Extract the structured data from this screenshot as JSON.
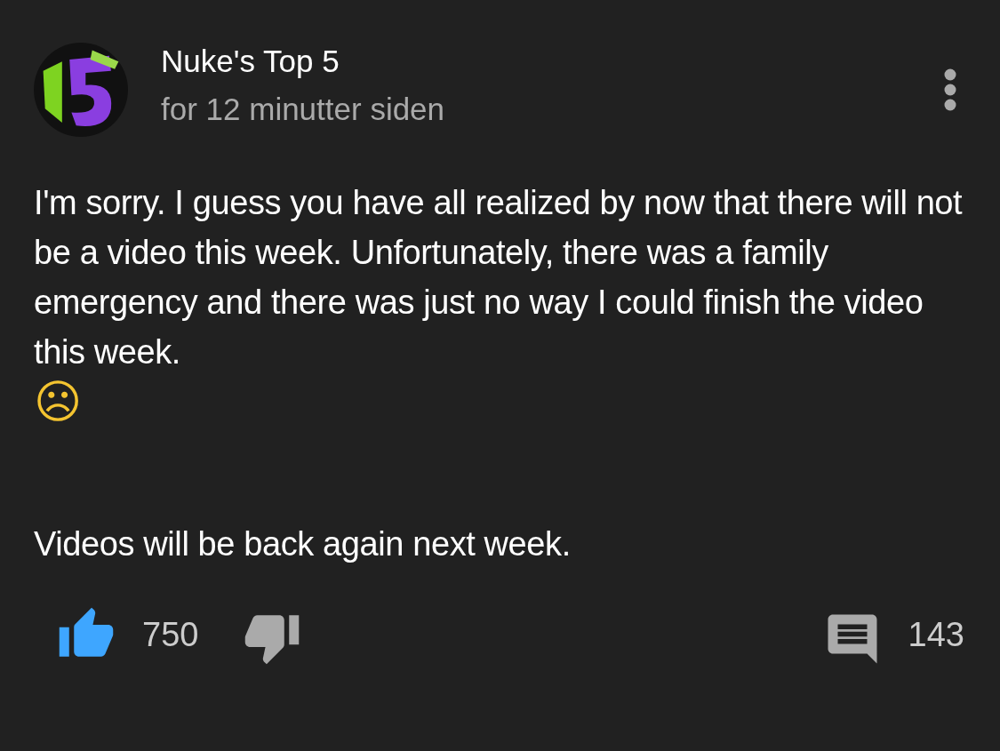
{
  "post": {
    "author": "Nuke's Top 5",
    "time": "for 12 minutter siden",
    "paragraphs": [
      "I'm sorry. I guess you have all realized by now that there will not be a video this week. Unfortunately, there was a family emergency and there was just no way I could finish the video this week."
    ],
    "emoji": "☹",
    "closing": "Videos will be back again next week.",
    "likes": "750",
    "liked": true,
    "disliked": false,
    "comments": "143"
  }
}
